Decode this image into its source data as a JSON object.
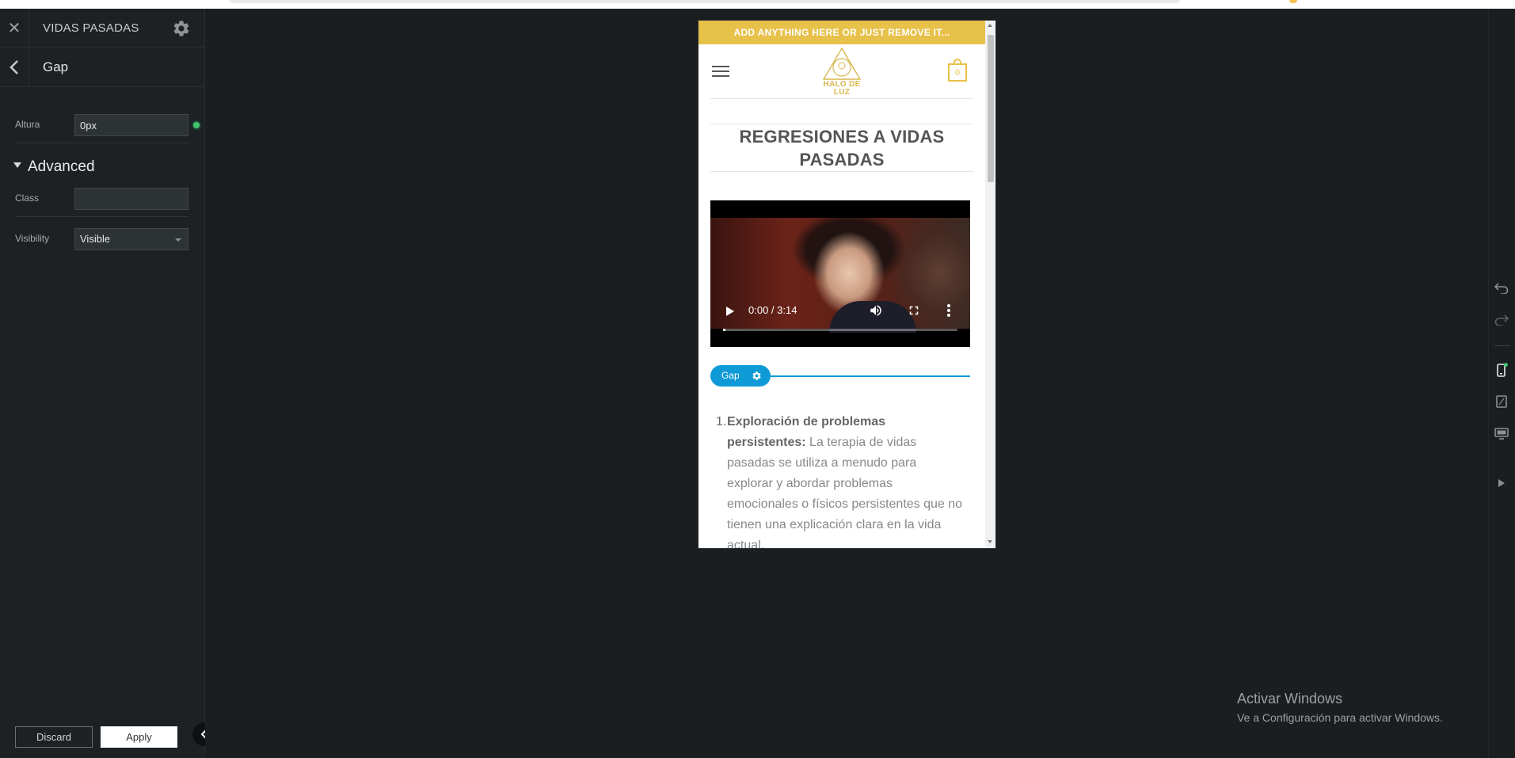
{
  "sidebar": {
    "title": "VIDAS PASADAS",
    "subtitle": "Gap",
    "fields": {
      "altura_label": "Altura",
      "altura_value": "0px",
      "advanced_label": "Advanced",
      "class_label": "Class",
      "class_value": "",
      "visibility_label": "Visibility",
      "visibility_value": "Visible"
    },
    "footer": {
      "discard_label": "Discard",
      "apply_label": "Apply"
    }
  },
  "preview": {
    "announcement": "ADD ANYTHING HERE OR JUST REMOVE IT...",
    "logo_text_line1": "HALO DE",
    "logo_text_line2": "LUZ",
    "cart_count": "0",
    "page_title_line1": "REGRESIONES A VIDAS",
    "page_title_line2": "PASADAS",
    "video": {
      "time": "0:00 / 3:14",
      "progress": 0
    },
    "gap_tag": "Gap",
    "list": [
      {
        "number": "1.",
        "bold_lead": "Exploración de problemas persistentes:",
        "text": " La terapia de vidas pasadas se utiliza a menudo para explorar y abordar problemas emocionales o físicos persistentes que no tienen una explicación clara en la vida actual."
      }
    ]
  },
  "watermark": {
    "line1": "Activar Windows",
    "line2": "Ve a Configuración para activar Windows."
  },
  "colors": {
    "accent_gold": "#e8c14a",
    "gap_blue": "#0d9ad6",
    "status_green": "#3ec46d",
    "panel_bg": "#1d2124",
    "canvas_bg": "#1b1e20"
  },
  "icons": {
    "close": "close-icon",
    "settings": "gear-icon",
    "back": "chevron-left-icon",
    "undo": "undo-icon",
    "redo": "redo-icon",
    "mobile": "mobile-device-icon",
    "tablet": "tablet-device-icon",
    "desktop": "desktop-device-icon",
    "preview": "play-icon",
    "menu": "hamburger-icon",
    "cart": "shopping-bag-icon"
  }
}
